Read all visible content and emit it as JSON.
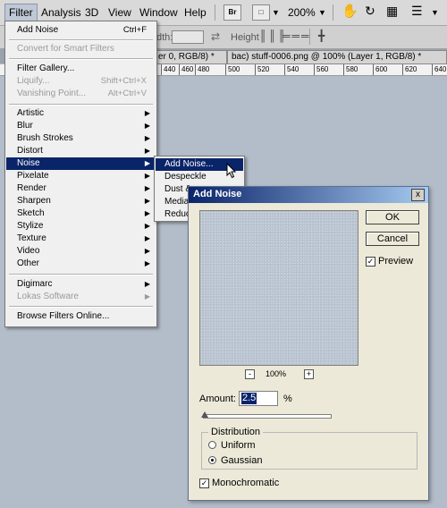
{
  "menubar": {
    "items": [
      "Filter",
      "Analysis",
      "3D",
      "View",
      "Window",
      "Help"
    ],
    "br_label": "Br",
    "zoom": "200%"
  },
  "options_bar": {
    "width_label": "dth:",
    "height_label": "Height"
  },
  "doc_tabs": [
    "er 0, RGB/8) *",
    "bac) stuff-0006.png @ 100% (Layer 1, RGB/8) *"
  ],
  "ruler_ticks": [
    "440",
    "460",
    "480",
    "500",
    "520",
    "540",
    "560",
    "580",
    "600",
    "620",
    "640"
  ],
  "filter_menu": {
    "last_filter": {
      "label": "Add Noise",
      "shortcut": "Ctrl+F"
    },
    "convert": "Convert for Smart Filters",
    "gallery": "Filter Gallery...",
    "liquify": {
      "label": "Liquify...",
      "shortcut": "Shift+Ctrl+X"
    },
    "vanishing": {
      "label": "Vanishing Point...",
      "shortcut": "Alt+Ctrl+V"
    },
    "categories": [
      "Artistic",
      "Blur",
      "Brush Strokes",
      "Distort",
      "Noise",
      "Pixelate",
      "Render",
      "Sharpen",
      "Sketch",
      "Stylize",
      "Texture",
      "Video",
      "Other"
    ],
    "digimarc": "Digimarc",
    "lokas": "Lokas Software",
    "browse": "Browse Filters Online..."
  },
  "noise_submenu": [
    "Add Noise...",
    "Despeckle",
    "Dust &",
    "Median",
    "Reduce"
  ],
  "dialog": {
    "title": "Add Noise",
    "close": "x",
    "ok": "OK",
    "cancel": "Cancel",
    "preview_label": "Preview",
    "preview_checked": true,
    "zoom_minus": "-",
    "zoom_level": "100%",
    "zoom_plus": "+",
    "amount_label": "Amount:",
    "amount_value": "2.5",
    "amount_unit": "%",
    "distribution_label": "Distribution",
    "uniform_label": "Uniform",
    "gaussian_label": "Gaussian",
    "selected_distribution": "Gaussian",
    "monochromatic_label": "Monochromatic",
    "monochromatic_checked": true
  }
}
